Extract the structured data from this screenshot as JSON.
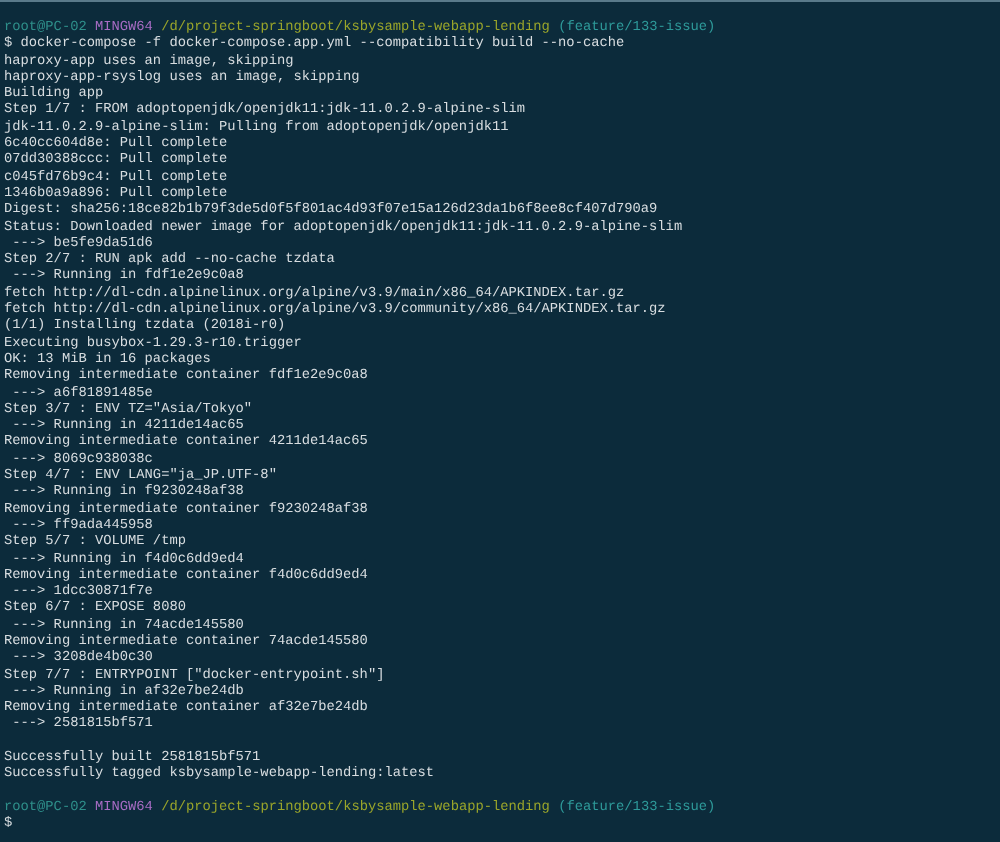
{
  "terminal": {
    "lines": [
      {
        "kind": "prompt",
        "user": "root@PC-02",
        "system": "MINGW64",
        "path": "/d/project-springboot/ksbysample-webapp-lending",
        "branch": "(feature/133-issue)"
      },
      {
        "kind": "text",
        "text": "$ docker-compose -f docker-compose.app.yml --compatibility build --no-cache"
      },
      {
        "kind": "text",
        "text": "haproxy-app uses an image, skipping"
      },
      {
        "kind": "text",
        "text": "haproxy-app-rsyslog uses an image, skipping"
      },
      {
        "kind": "text",
        "text": "Building app"
      },
      {
        "kind": "text",
        "text": "Step 1/7 : FROM adoptopenjdk/openjdk11:jdk-11.0.2.9-alpine-slim"
      },
      {
        "kind": "text",
        "text": "jdk-11.0.2.9-alpine-slim: Pulling from adoptopenjdk/openjdk11"
      },
      {
        "kind": "text",
        "text": "6c40cc604d8e: Pull complete"
      },
      {
        "kind": "text",
        "text": "07dd30388ccc: Pull complete"
      },
      {
        "kind": "text",
        "text": "c045fd76b9c4: Pull complete"
      },
      {
        "kind": "text",
        "text": "1346b0a9a896: Pull complete"
      },
      {
        "kind": "text",
        "text": "Digest: sha256:18ce82b1b79f3de5d0f5f801ac4d93f07e15a126d23da1b6f8ee8cf407d790a9"
      },
      {
        "kind": "text",
        "text": "Status: Downloaded newer image for adoptopenjdk/openjdk11:jdk-11.0.2.9-alpine-slim"
      },
      {
        "kind": "text",
        "text": " ---> be5fe9da51d6"
      },
      {
        "kind": "text",
        "text": "Step 2/7 : RUN apk add --no-cache tzdata"
      },
      {
        "kind": "text",
        "text": " ---> Running in fdf1e2e9c0a8"
      },
      {
        "kind": "text",
        "text": "fetch http://dl-cdn.alpinelinux.org/alpine/v3.9/main/x86_64/APKINDEX.tar.gz"
      },
      {
        "kind": "text",
        "text": "fetch http://dl-cdn.alpinelinux.org/alpine/v3.9/community/x86_64/APKINDEX.tar.gz"
      },
      {
        "kind": "text",
        "text": "(1/1) Installing tzdata (2018i-r0)"
      },
      {
        "kind": "text",
        "text": "Executing busybox-1.29.3-r10.trigger"
      },
      {
        "kind": "text",
        "text": "OK: 13 MiB in 16 packages"
      },
      {
        "kind": "text",
        "text": "Removing intermediate container fdf1e2e9c0a8"
      },
      {
        "kind": "text",
        "text": " ---> a6f81891485e"
      },
      {
        "kind": "text",
        "text": "Step 3/7 : ENV TZ=\"Asia/Tokyo\""
      },
      {
        "kind": "text",
        "text": " ---> Running in 4211de14ac65"
      },
      {
        "kind": "text",
        "text": "Removing intermediate container 4211de14ac65"
      },
      {
        "kind": "text",
        "text": " ---> 8069c938038c"
      },
      {
        "kind": "text",
        "text": "Step 4/7 : ENV LANG=\"ja_JP.UTF-8\""
      },
      {
        "kind": "text",
        "text": " ---> Running in f9230248af38"
      },
      {
        "kind": "text",
        "text": "Removing intermediate container f9230248af38"
      },
      {
        "kind": "text",
        "text": " ---> ff9ada445958"
      },
      {
        "kind": "text",
        "text": "Step 5/7 : VOLUME /tmp"
      },
      {
        "kind": "text",
        "text": " ---> Running in f4d0c6dd9ed4"
      },
      {
        "kind": "text",
        "text": "Removing intermediate container f4d0c6dd9ed4"
      },
      {
        "kind": "text",
        "text": " ---> 1dcc30871f7e"
      },
      {
        "kind": "text",
        "text": "Step 6/7 : EXPOSE 8080"
      },
      {
        "kind": "text",
        "text": " ---> Running in 74acde145580"
      },
      {
        "kind": "text",
        "text": "Removing intermediate container 74acde145580"
      },
      {
        "kind": "text",
        "text": " ---> 3208de4b0c30"
      },
      {
        "kind": "text",
        "text": "Step 7/7 : ENTRYPOINT [\"docker-entrypoint.sh\"]"
      },
      {
        "kind": "text",
        "text": " ---> Running in af32e7be24db"
      },
      {
        "kind": "text",
        "text": "Removing intermediate container af32e7be24db"
      },
      {
        "kind": "text",
        "text": " ---> 2581815bf571"
      },
      {
        "kind": "blank"
      },
      {
        "kind": "text",
        "text": "Successfully built 2581815bf571"
      },
      {
        "kind": "text",
        "text": "Successfully tagged ksbysample-webapp-lending:latest"
      },
      {
        "kind": "blank"
      },
      {
        "kind": "prompt",
        "user": "root@PC-02",
        "system": "MINGW64",
        "path": "/d/project-springboot/ksbysample-webapp-lending",
        "branch": "(feature/133-issue)"
      },
      {
        "kind": "text",
        "text": "$"
      }
    ]
  }
}
